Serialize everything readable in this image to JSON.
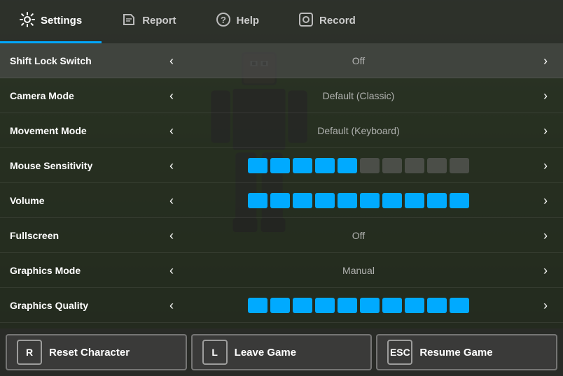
{
  "nav": {
    "tabs": [
      {
        "id": "settings",
        "label": "Settings",
        "icon": "⚙",
        "active": true
      },
      {
        "id": "report",
        "label": "Report",
        "icon": "⚑",
        "active": false
      },
      {
        "id": "help",
        "label": "Help",
        "icon": "?",
        "active": false
      },
      {
        "id": "record",
        "label": "Record",
        "icon": "◎",
        "active": false
      }
    ]
  },
  "settings": {
    "rows": [
      {
        "id": "shift-lock",
        "label": "Shift Lock Switch",
        "type": "value",
        "value": "Off",
        "highlighted": true
      },
      {
        "id": "camera-mode",
        "label": "Camera Mode",
        "type": "value",
        "value": "Default (Classic)",
        "highlighted": false
      },
      {
        "id": "movement-mode",
        "label": "Movement Mode",
        "type": "value",
        "value": "Default (Keyboard)",
        "highlighted": false
      },
      {
        "id": "mouse-sensitivity",
        "label": "Mouse Sensitivity",
        "type": "slider",
        "activeCount": 5,
        "totalCount": 10,
        "highlighted": false
      },
      {
        "id": "volume",
        "label": "Volume",
        "type": "slider",
        "activeCount": 10,
        "totalCount": 10,
        "highlighted": false
      },
      {
        "id": "fullscreen",
        "label": "Fullscreen",
        "type": "value",
        "value": "Off",
        "highlighted": false
      },
      {
        "id": "graphics-mode",
        "label": "Graphics Mode",
        "type": "value",
        "value": "Manual",
        "highlighted": false
      },
      {
        "id": "graphics-quality",
        "label": "Graphics Quality",
        "type": "slider",
        "activeCount": 10,
        "totalCount": 10,
        "highlighted": false
      }
    ]
  },
  "actions": [
    {
      "id": "reset",
      "key": "R",
      "label": "Reset Character"
    },
    {
      "id": "leave",
      "key": "L",
      "label": "Leave Game"
    },
    {
      "id": "resume",
      "key": "ESC",
      "label": "Resume Game"
    }
  ],
  "colors": {
    "accent": "#00aaff",
    "bg_dark": "rgba(30,30,30,0.82)",
    "nav_bg": "rgba(40,40,40,0.92)"
  }
}
